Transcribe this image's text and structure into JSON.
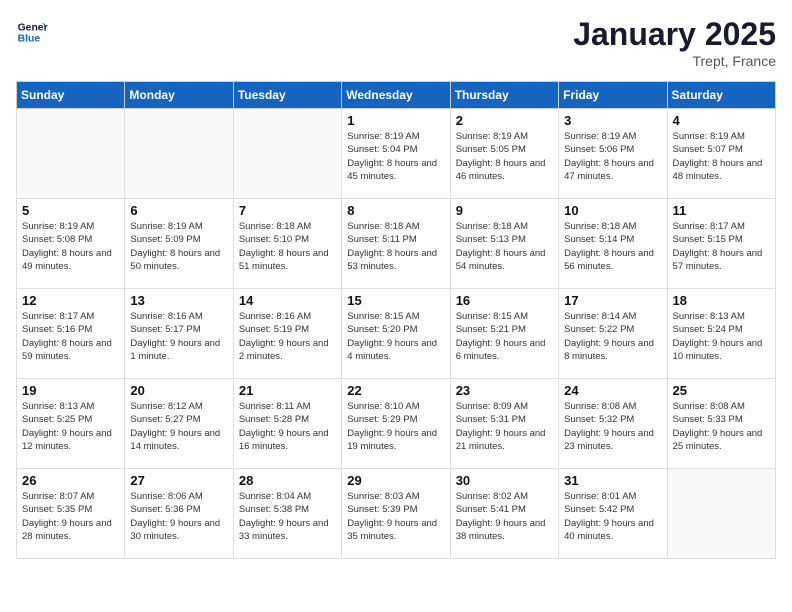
{
  "logo": {
    "text_general": "General",
    "text_blue": "Blue"
  },
  "title": "January 2025",
  "subtitle": "Trept, France",
  "days_of_week": [
    "Sunday",
    "Monday",
    "Tuesday",
    "Wednesday",
    "Thursday",
    "Friday",
    "Saturday"
  ],
  "weeks": [
    [
      {
        "day": "",
        "empty": true
      },
      {
        "day": "",
        "empty": true
      },
      {
        "day": "",
        "empty": true
      },
      {
        "day": "1",
        "sunrise": "8:19 AM",
        "sunset": "5:04 PM",
        "daylight": "8 hours and 45 minutes."
      },
      {
        "day": "2",
        "sunrise": "8:19 AM",
        "sunset": "5:05 PM",
        "daylight": "8 hours and 46 minutes."
      },
      {
        "day": "3",
        "sunrise": "8:19 AM",
        "sunset": "5:06 PM",
        "daylight": "8 hours and 47 minutes."
      },
      {
        "day": "4",
        "sunrise": "8:19 AM",
        "sunset": "5:07 PM",
        "daylight": "8 hours and 48 minutes."
      }
    ],
    [
      {
        "day": "5",
        "sunrise": "8:19 AM",
        "sunset": "5:08 PM",
        "daylight": "8 hours and 49 minutes."
      },
      {
        "day": "6",
        "sunrise": "8:19 AM",
        "sunset": "5:09 PM",
        "daylight": "8 hours and 50 minutes."
      },
      {
        "day": "7",
        "sunrise": "8:18 AM",
        "sunset": "5:10 PM",
        "daylight": "8 hours and 51 minutes."
      },
      {
        "day": "8",
        "sunrise": "8:18 AM",
        "sunset": "5:11 PM",
        "daylight": "8 hours and 53 minutes."
      },
      {
        "day": "9",
        "sunrise": "8:18 AM",
        "sunset": "5:13 PM",
        "daylight": "8 hours and 54 minutes."
      },
      {
        "day": "10",
        "sunrise": "8:18 AM",
        "sunset": "5:14 PM",
        "daylight": "8 hours and 56 minutes."
      },
      {
        "day": "11",
        "sunrise": "8:17 AM",
        "sunset": "5:15 PM",
        "daylight": "8 hours and 57 minutes."
      }
    ],
    [
      {
        "day": "12",
        "sunrise": "8:17 AM",
        "sunset": "5:16 PM",
        "daylight": "8 hours and 59 minutes."
      },
      {
        "day": "13",
        "sunrise": "8:16 AM",
        "sunset": "5:17 PM",
        "daylight": "9 hours and 1 minute."
      },
      {
        "day": "14",
        "sunrise": "8:16 AM",
        "sunset": "5:19 PM",
        "daylight": "9 hours and 2 minutes."
      },
      {
        "day": "15",
        "sunrise": "8:15 AM",
        "sunset": "5:20 PM",
        "daylight": "9 hours and 4 minutes."
      },
      {
        "day": "16",
        "sunrise": "8:15 AM",
        "sunset": "5:21 PM",
        "daylight": "9 hours and 6 minutes."
      },
      {
        "day": "17",
        "sunrise": "8:14 AM",
        "sunset": "5:22 PM",
        "daylight": "9 hours and 8 minutes."
      },
      {
        "day": "18",
        "sunrise": "8:13 AM",
        "sunset": "5:24 PM",
        "daylight": "9 hours and 10 minutes."
      }
    ],
    [
      {
        "day": "19",
        "sunrise": "8:13 AM",
        "sunset": "5:25 PM",
        "daylight": "9 hours and 12 minutes."
      },
      {
        "day": "20",
        "sunrise": "8:12 AM",
        "sunset": "5:27 PM",
        "daylight": "9 hours and 14 minutes."
      },
      {
        "day": "21",
        "sunrise": "8:11 AM",
        "sunset": "5:28 PM",
        "daylight": "9 hours and 16 minutes."
      },
      {
        "day": "22",
        "sunrise": "8:10 AM",
        "sunset": "5:29 PM",
        "daylight": "9 hours and 19 minutes."
      },
      {
        "day": "23",
        "sunrise": "8:09 AM",
        "sunset": "5:31 PM",
        "daylight": "9 hours and 21 minutes."
      },
      {
        "day": "24",
        "sunrise": "8:08 AM",
        "sunset": "5:32 PM",
        "daylight": "9 hours and 23 minutes."
      },
      {
        "day": "25",
        "sunrise": "8:08 AM",
        "sunset": "5:33 PM",
        "daylight": "9 hours and 25 minutes."
      }
    ],
    [
      {
        "day": "26",
        "sunrise": "8:07 AM",
        "sunset": "5:35 PM",
        "daylight": "9 hours and 28 minutes."
      },
      {
        "day": "27",
        "sunrise": "8:06 AM",
        "sunset": "5:36 PM",
        "daylight": "9 hours and 30 minutes."
      },
      {
        "day": "28",
        "sunrise": "8:04 AM",
        "sunset": "5:38 PM",
        "daylight": "9 hours and 33 minutes."
      },
      {
        "day": "29",
        "sunrise": "8:03 AM",
        "sunset": "5:39 PM",
        "daylight": "9 hours and 35 minutes."
      },
      {
        "day": "30",
        "sunrise": "8:02 AM",
        "sunset": "5:41 PM",
        "daylight": "9 hours and 38 minutes."
      },
      {
        "day": "31",
        "sunrise": "8:01 AM",
        "sunset": "5:42 PM",
        "daylight": "9 hours and 40 minutes."
      },
      {
        "day": "",
        "empty": true
      }
    ]
  ]
}
